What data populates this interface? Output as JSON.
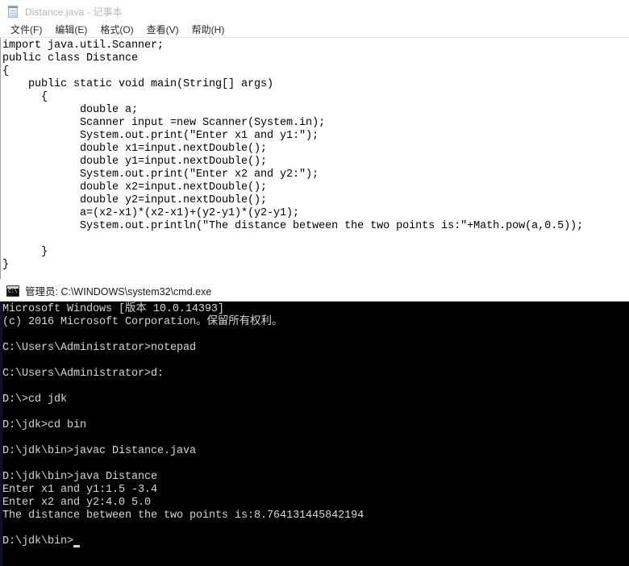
{
  "notepad": {
    "title": "Distance.java - 记事本",
    "icon": "notepad-icon",
    "menu": [
      {
        "label": "文件(F)"
      },
      {
        "label": "编辑(E)"
      },
      {
        "label": "格式(O)"
      },
      {
        "label": "查看(V)"
      },
      {
        "label": "帮助(H)"
      }
    ],
    "code": "import java.util.Scanner;\npublic class Distance\n{\n    public static void main(String[] args)\n      {\n            double a;\n            Scanner input =new Scanner(System.in);\n            System.out.print(\"Enter x1 and y1:\");\n            double x1=input.nextDouble();\n            double y1=input.nextDouble();\n            System.out.print(\"Enter x2 and y2:\");\n            double x2=input.nextDouble();\n            double y2=input.nextDouble();\n            a=(x2-x1)*(x2-x1)+(y2-y1)*(y2-y1);\n            System.out.println(\"The distance between the two points is:\"+Math.pow(a,0.5));\n\n      }\n}"
  },
  "cmd": {
    "title": "管理员: C:\\WINDOWS\\system32\\cmd.exe",
    "icon": "cmd-icon",
    "icon_prompt": "C:\\",
    "output": "Microsoft Windows [版本 10.0.14393]\n(c) 2016 Microsoft Corporation。保留所有权利。\n\nC:\\Users\\Administrator>notepad\n\nC:\\Users\\Administrator>d:\n\nD:\\>cd jdk\n\nD:\\jdk>cd bin\n\nD:\\jdk\\bin>javac Distance.java\n\nD:\\jdk\\bin>java Distance\nEnter x1 and y1:1.5 -3.4\nEnter x2 and y2:4.0 5.0\nThe distance between the two points is:8.764131445842194\n\nD:\\jdk\\bin>",
    "cursor": "▂"
  },
  "colors": {
    "console_bg": "#000000",
    "console_fg": "#d6d6d6",
    "window_bg": "#ffffff",
    "title_inactive": "#b6b6b6"
  }
}
